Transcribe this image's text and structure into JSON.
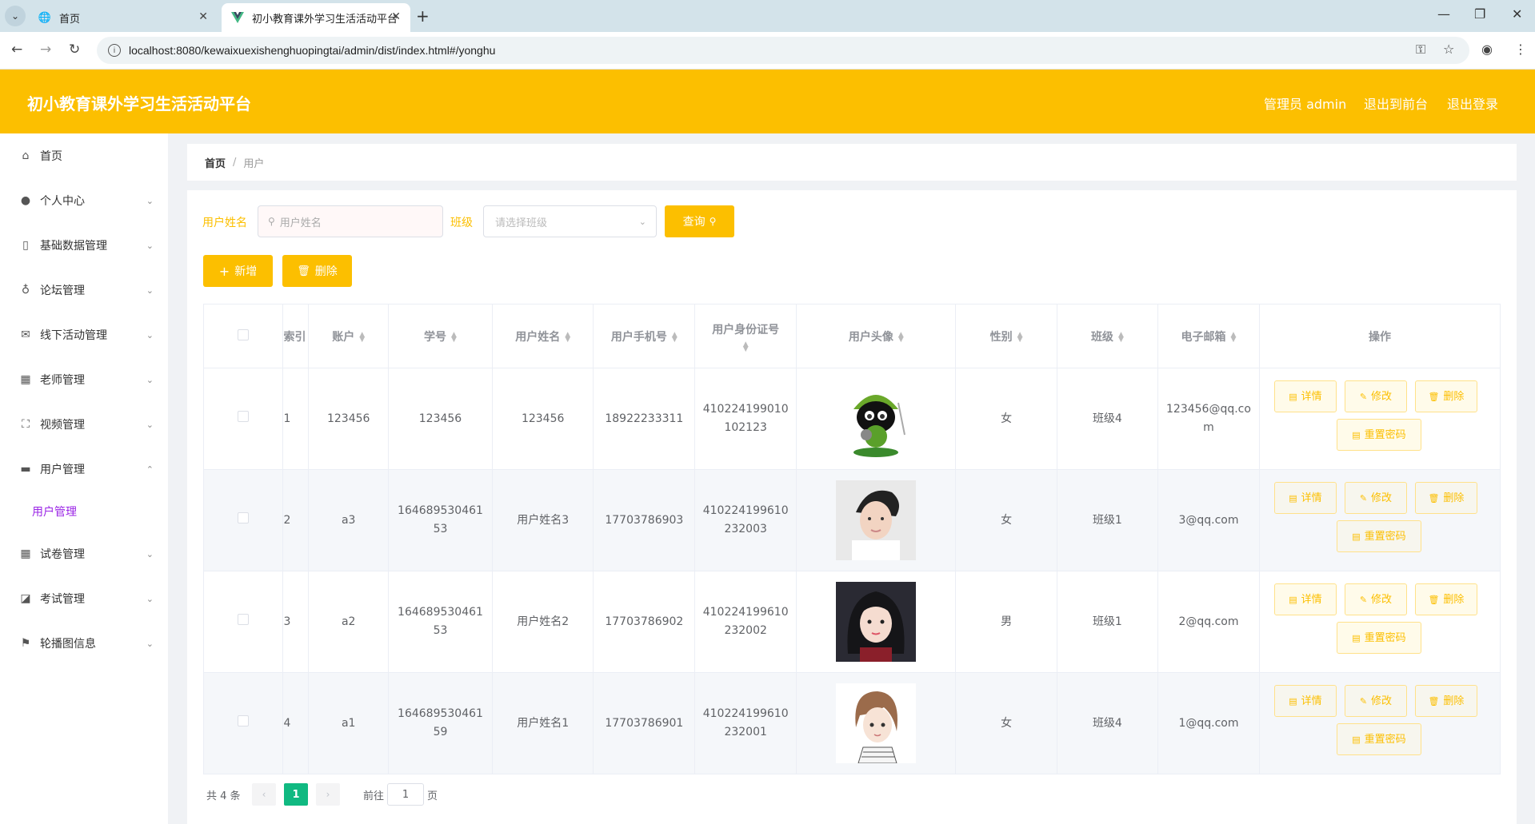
{
  "browser": {
    "tabs": [
      {
        "title": "首页"
      },
      {
        "title": "初小教育课外学习生活活动平台"
      }
    ],
    "url": "localhost:8080/kewaixuexishenghuopingtai/admin/dist/index.html#/yonghu"
  },
  "header": {
    "title": "初小教育课外学习生活活动平台",
    "user": "管理员 admin",
    "to_front": "退出到前台",
    "logout": "退出登录"
  },
  "sidebar": {
    "items": [
      {
        "label": "首页",
        "icon": "home-icon"
      },
      {
        "label": "个人中心",
        "icon": "user-icon"
      },
      {
        "label": "基础数据管理",
        "icon": "phone-icon"
      },
      {
        "label": "论坛管理",
        "icon": "microphone-icon"
      },
      {
        "label": "线下活动管理",
        "icon": "mail-icon"
      },
      {
        "label": "老师管理",
        "icon": "calculator-icon"
      },
      {
        "label": "视频管理",
        "icon": "fullscreen-icon"
      },
      {
        "label": "用户管理",
        "icon": "briefcase-icon"
      },
      {
        "label": "试卷管理",
        "icon": "grid-icon"
      },
      {
        "label": "考试管理",
        "icon": "chart-icon"
      },
      {
        "label": "轮播图信息",
        "icon": "flag-icon"
      }
    ],
    "sub_active": "用户管理"
  },
  "breadcrumb": {
    "home": "首页",
    "sep": "/",
    "current": "用户"
  },
  "filters": {
    "name_label": "用户姓名",
    "name_placeholder": "用户姓名",
    "class_label": "班级",
    "class_placeholder": "请选择班级",
    "query": "查询"
  },
  "actions": {
    "add": "新增",
    "delete": "删除"
  },
  "table": {
    "headers": [
      "索引",
      "账户",
      "学号",
      "用户姓名",
      "用户手机号",
      "用户身份证号",
      "用户头像",
      "性别",
      "班级",
      "电子邮箱",
      "操作"
    ],
    "rows": [
      {
        "index": "1",
        "account": "123456",
        "student_no": [
          "123456"
        ],
        "name": "123456",
        "phone": "18922233311",
        "id_card": [
          "410224199010",
          "102123"
        ],
        "gender": "女",
        "class": "班级4",
        "email": [
          "123456@qq.co",
          "m"
        ],
        "avatar": "cartoon-avatar"
      },
      {
        "index": "2",
        "account": "a3",
        "student_no": [
          "164689530461",
          "53"
        ],
        "name": "用户姓名3",
        "phone": "17703786903",
        "id_card": [
          "410224199610",
          "232003"
        ],
        "gender": "女",
        "class": "班级1",
        "email": [
          "3@qq.com"
        ],
        "avatar": "photo-male"
      },
      {
        "index": "3",
        "account": "a2",
        "student_no": [
          "164689530461",
          "53"
        ],
        "name": "用户姓名2",
        "phone": "17703786902",
        "id_card": [
          "410224199610",
          "232002"
        ],
        "gender": "男",
        "class": "班级1",
        "email": [
          "2@qq.com"
        ],
        "avatar": "photo-female"
      },
      {
        "index": "4",
        "account": "a1",
        "student_no": [
          "164689530461",
          "59"
        ],
        "name": "用户姓名1",
        "phone": "17703786901",
        "id_card": [
          "410224199610",
          "232001"
        ],
        "gender": "女",
        "class": "班级4",
        "email": [
          "1@qq.com"
        ],
        "avatar": "drawn-girl"
      }
    ],
    "ops": {
      "detail": "详情",
      "edit": "修改",
      "delete": "删除",
      "reset": "重置密码"
    }
  },
  "pagination": {
    "total": "共 4 条",
    "current": "1",
    "goto": "前往",
    "page_value": "1",
    "page_unit": "页"
  },
  "colors": {
    "accent": "#fcbf00",
    "active_page": "#10b981",
    "submenu_active": "#9b26e6"
  }
}
